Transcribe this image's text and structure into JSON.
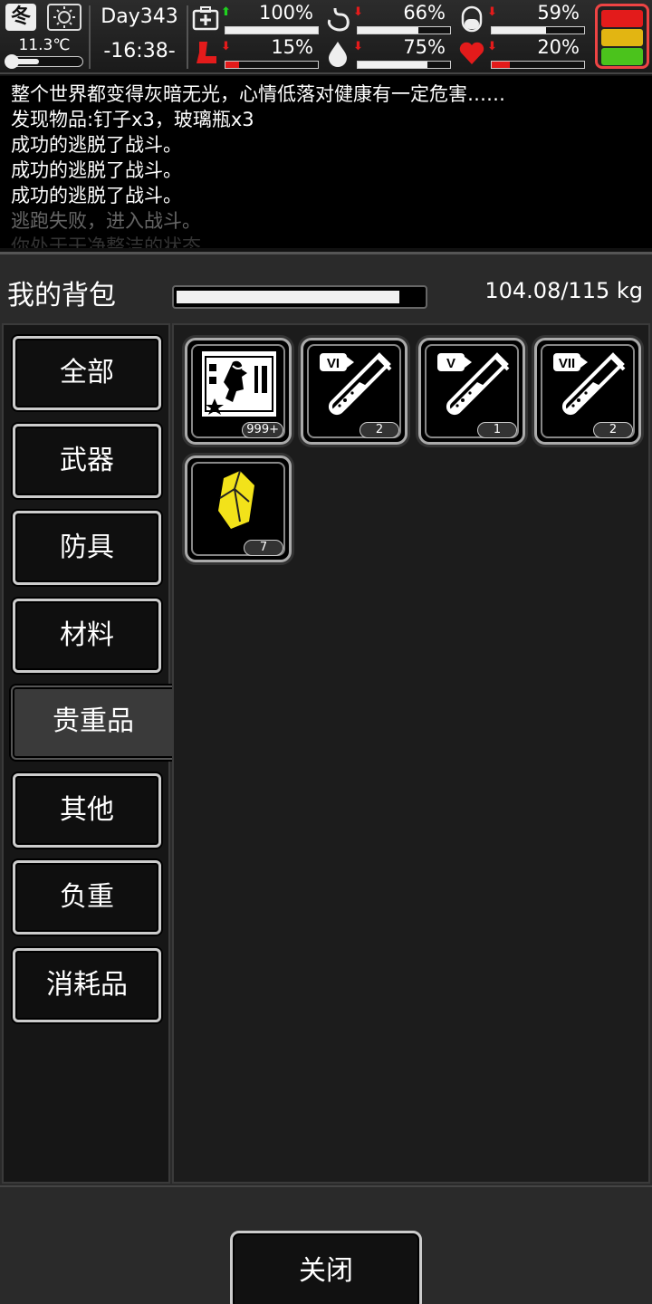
{
  "status": {
    "season": "冬",
    "temperature": "11.3℃",
    "day": "Day343",
    "time": "-16:38-",
    "stats": [
      {
        "name": "health",
        "icon": "medkit-icon",
        "arrow": "up",
        "percent": "100%",
        "level": 1.0
      },
      {
        "name": "hunger",
        "icon": "stomach-icon",
        "arrow": "down",
        "percent": "66%",
        "level": 0.66
      },
      {
        "name": "medicine",
        "icon": "pill-icon",
        "arrow": "down",
        "percent": "59%",
        "level": 0.59
      },
      {
        "name": "stamina",
        "icon": "boot-icon",
        "arrow": "down",
        "percent": "15%",
        "level": 0.15
      },
      {
        "name": "thirst",
        "icon": "water-drop-icon",
        "arrow": "down",
        "percent": "75%",
        "level": 0.75
      },
      {
        "name": "mood",
        "icon": "heart-icon",
        "arrow": "down",
        "percent": "20%",
        "level": 0.2
      }
    ],
    "colors": {
      "up": "#1fd11f",
      "down": "#e31b1b",
      "red": "#e31b1b",
      "yellow": "#e2b512",
      "green": "#4bc31c"
    }
  },
  "log": [
    {
      "text": "整个世界都变得灰暗无光，心情低落对健康有一定危害……",
      "style": "normal"
    },
    {
      "text": "发现物品:钉子x3，玻璃瓶x3",
      "style": "normal"
    },
    {
      "text": "成功的逃脱了战斗。",
      "style": "normal"
    },
    {
      "text": "成功的逃脱了战斗。",
      "style": "normal"
    },
    {
      "text": "成功的逃脱了战斗。",
      "style": "normal"
    },
    {
      "text": "逃跑失败，进入战斗。",
      "style": "dim1"
    },
    {
      "text": "你处于干净整洁的状态",
      "style": "dim2"
    }
  ],
  "backpack": {
    "title": "我的背包",
    "weight": "104.08/115 kg",
    "weight_fraction": 0.905
  },
  "categories": [
    {
      "label": "全部",
      "active": false
    },
    {
      "label": "武器",
      "active": false
    },
    {
      "label": "防具",
      "active": false
    },
    {
      "label": "材料",
      "active": false
    },
    {
      "label": "贵重品",
      "active": true
    },
    {
      "label": "其他",
      "active": false
    },
    {
      "label": "负重",
      "active": false
    },
    {
      "label": "消耗品",
      "active": false
    }
  ],
  "items": [
    {
      "icon": "zombie-card-icon",
      "count": "999+"
    },
    {
      "icon": "test-tube-vi-icon",
      "roman": "VI",
      "count": "2"
    },
    {
      "icon": "test-tube-v-icon",
      "roman": "V",
      "count": "1"
    },
    {
      "icon": "test-tube-vii-icon",
      "roman": "VII",
      "count": "2"
    },
    {
      "icon": "gold-crystal-icon",
      "count": "7"
    }
  ],
  "footer": {
    "close_label": "关闭"
  }
}
